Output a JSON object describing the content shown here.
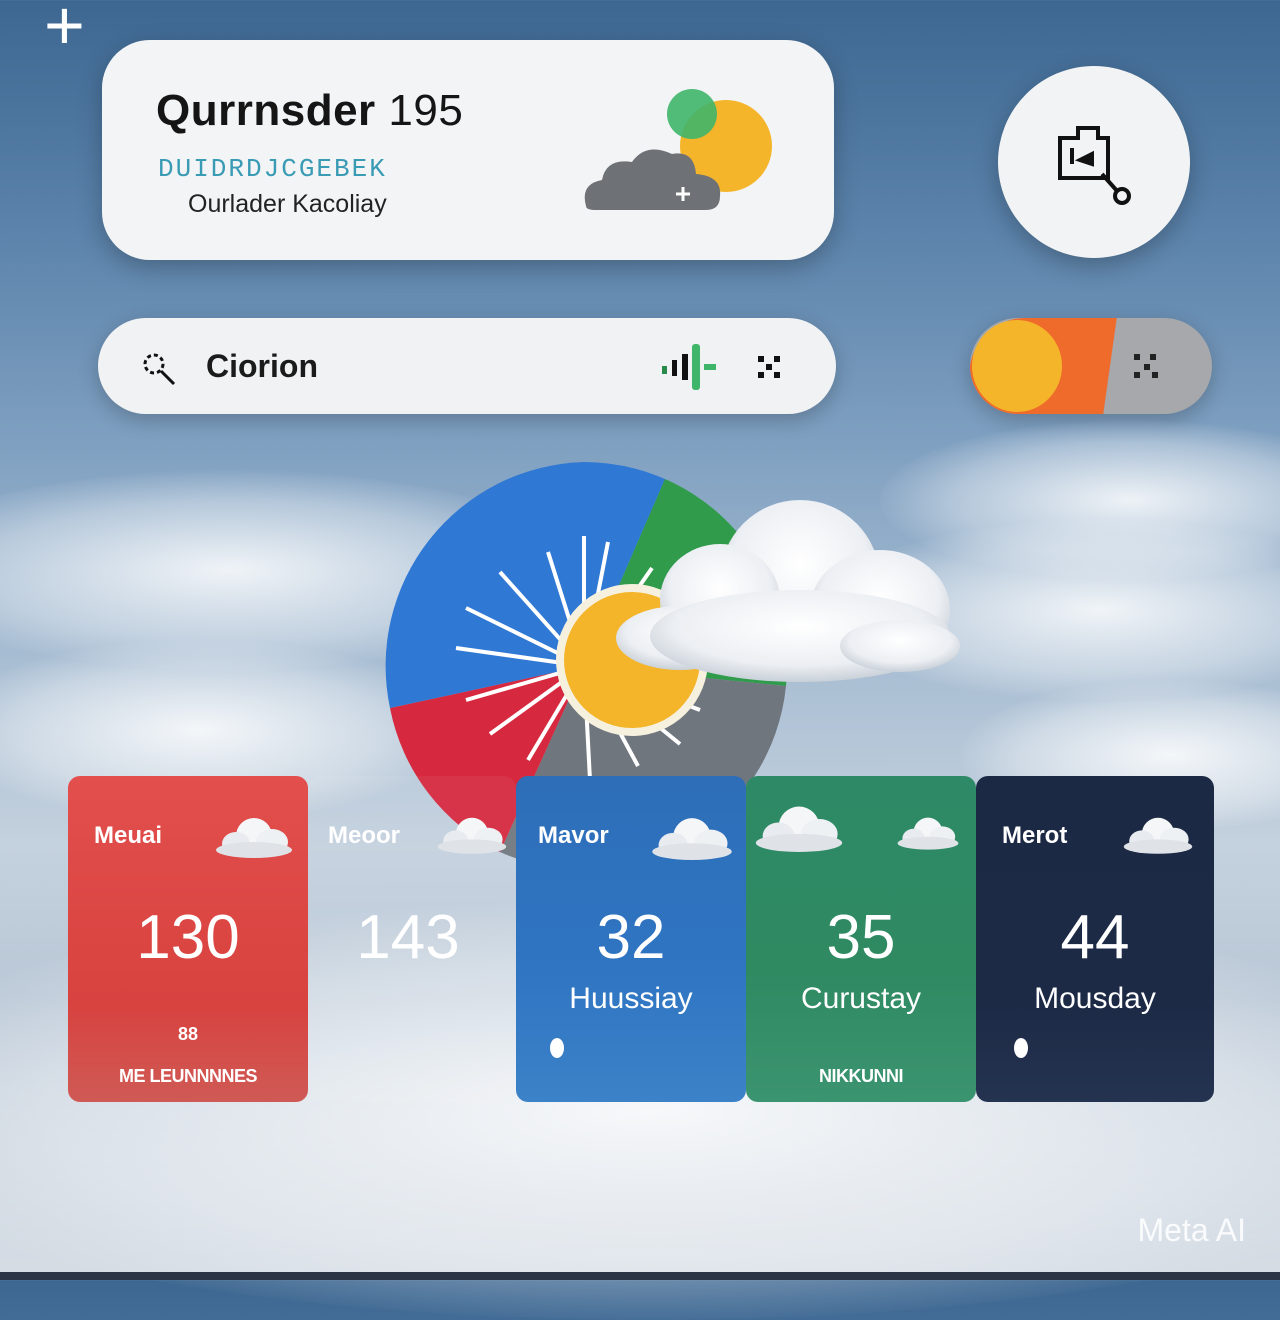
{
  "header": {
    "title": "Qurrnsder",
    "title_number": "195",
    "subtitle": "DUIDRDJCGEBEK",
    "location": "Ourlader Kacoliay"
  },
  "search": {
    "text": "Ciorion"
  },
  "cards": [
    {
      "label": "Meuai",
      "value": "130",
      "day": "",
      "small1": "88",
      "small2": "ME LEUNNNNES",
      "color": "#e04848"
    },
    {
      "label": "Meoor",
      "value": "143",
      "day": "",
      "small1": "",
      "small2": "",
      "color": "transparent"
    },
    {
      "label": "Mavor",
      "value": "32",
      "day": "Huussiay",
      "small1": "",
      "small2": "",
      "color": "#2f73bd"
    },
    {
      "label": "",
      "value": "35",
      "day": "Curustay",
      "small1": "",
      "small2": "NIKKUNNI",
      "color": "#2f8a63"
    },
    {
      "label": "Merot",
      "value": "44",
      "day": "Mousday",
      "small1": "",
      "small2": "",
      "color": "#1d2a44"
    }
  ],
  "icons": {
    "header_weather": "sun-cloud-icon",
    "round_button": "share-icon",
    "search": "search-icon",
    "signal": "signal-icon",
    "close": "close-icon",
    "toggle_dots": "dots-icon"
  },
  "colors": {
    "pie_blue": "#2f78d4",
    "pie_green": "#2f9b4b",
    "pie_red": "#d6283e",
    "pie_gray": "#70767e",
    "sun": "#f4b52b",
    "toggle_orange": "#ef6b2c"
  },
  "watermark": "Meta AI"
}
